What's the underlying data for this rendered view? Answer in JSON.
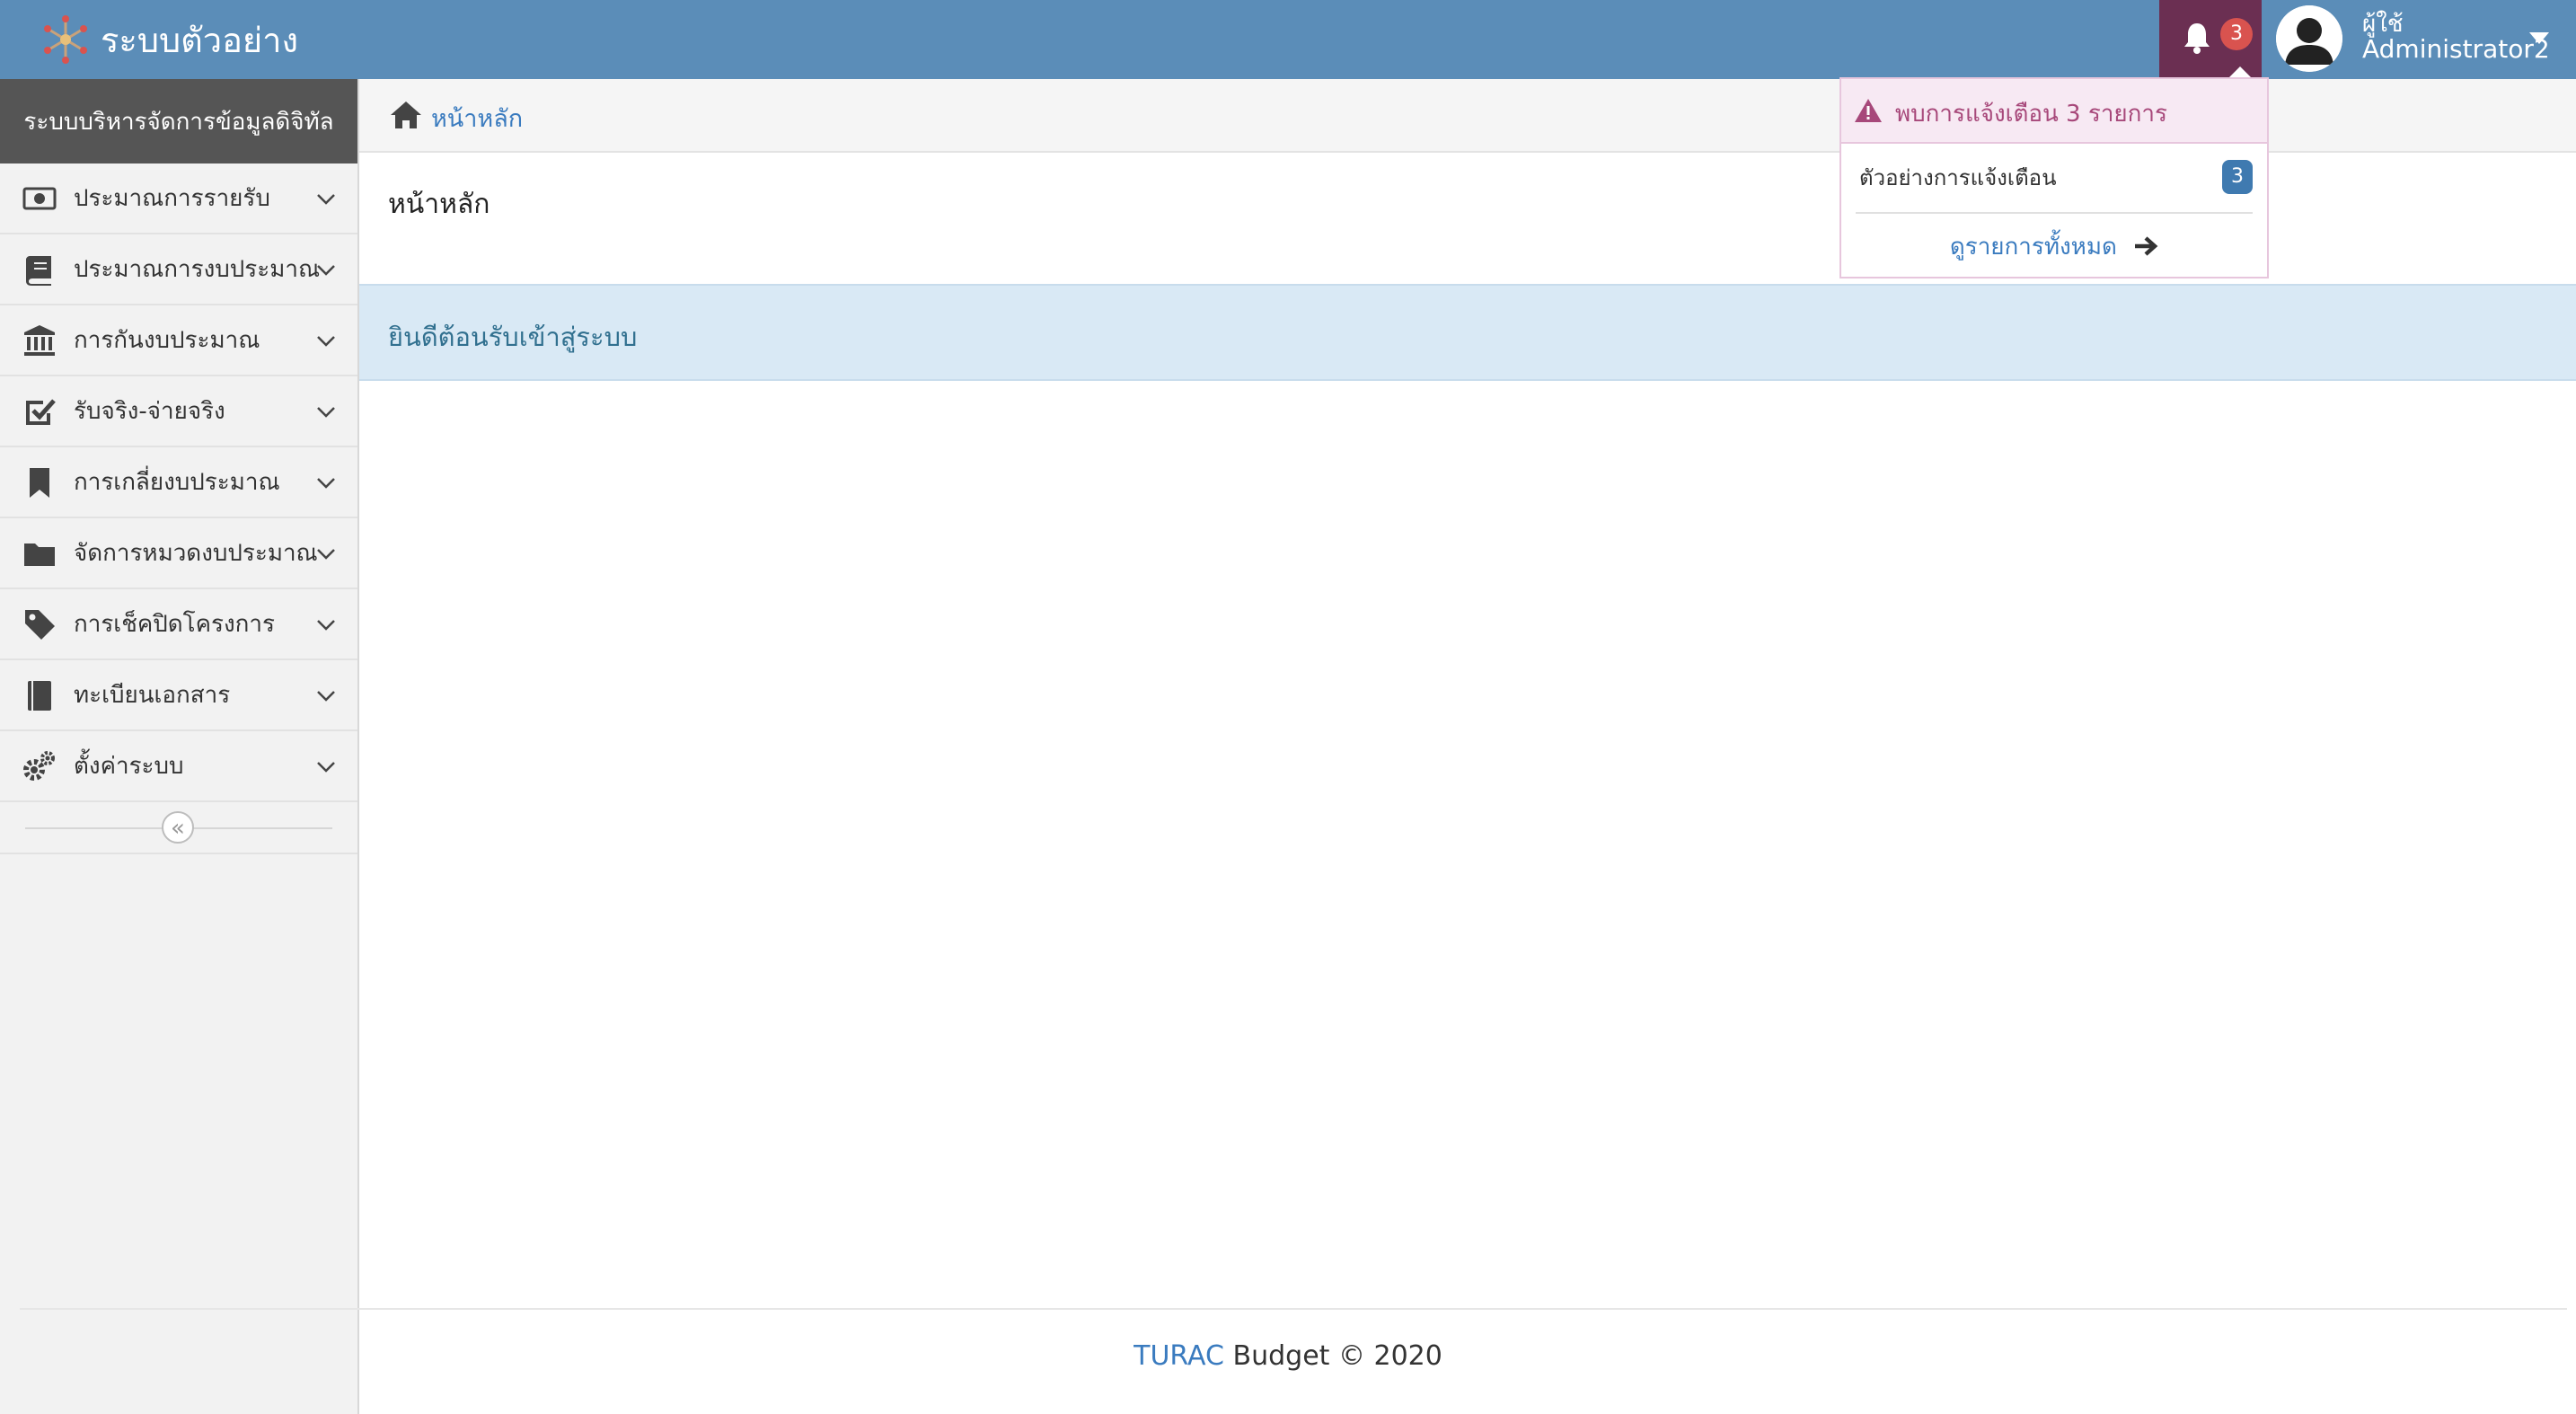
{
  "app": {
    "title": "ระบบตัวอย่าง",
    "accent_color": "#5b8db8"
  },
  "header": {
    "notifications_count": "3",
    "user_label": "ผู้ใช้",
    "user_name": "Administrator2",
    "logo_icon": "snowflake-logo-icon",
    "bell_icon": "bell-icon",
    "avatar_icon": "user-avatar-icon"
  },
  "sidebar": {
    "title": "ระบบบริหารจัดการข้อมูลดิจิทัล",
    "items": [
      {
        "label": "ประมาณการรายรับ",
        "icon": "money-bill-icon"
      },
      {
        "label": "ประมาณการงบประมาณ",
        "icon": "book-icon"
      },
      {
        "label": "การกันงบประมาณ",
        "icon": "bank-icon"
      },
      {
        "label": "รับจริง-จ่ายจริง",
        "icon": "check-square-icon"
      },
      {
        "label": "การเกลี่ยงบประมาณ",
        "icon": "bookmark-icon"
      },
      {
        "label": "จัดการหมวดงบประมาณ",
        "icon": "folder-icon"
      },
      {
        "label": "การเช็คปิดโครงการ",
        "icon": "tag-icon"
      },
      {
        "label": "ทะเบียนเอกสาร",
        "icon": "book-closed-icon"
      },
      {
        "label": "ตั้งค่าระบบ",
        "icon": "gears-icon"
      }
    ],
    "collapse_glyph": "«"
  },
  "breadcrumb": {
    "home": "หน้าหลัก"
  },
  "main": {
    "title": "หน้าหลัก",
    "welcome": "ยินดีต้อนรับเข้าสู่ระบบ"
  },
  "notifications": {
    "header": "พบการแจ้งเตือน 3 รายการ",
    "items": [
      {
        "label": "ตัวอย่างการแจ้งเตือน",
        "count": "3"
      }
    ],
    "view_all": "ดูรายการทั้งหมด"
  },
  "footer": {
    "brand": "TURAC",
    "text": " Budget © 2020"
  }
}
